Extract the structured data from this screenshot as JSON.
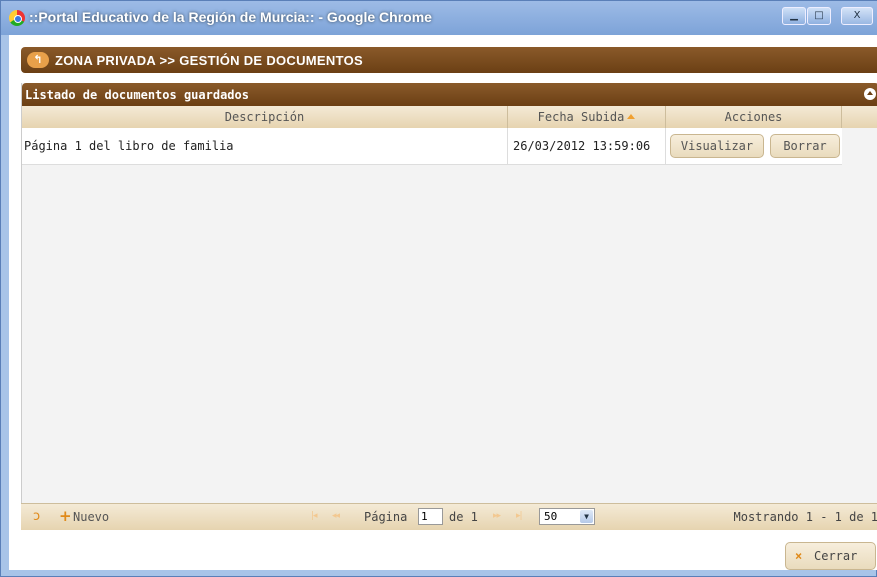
{
  "window": {
    "title": "::Portal Educativo de la Región de Murcia:: - Google Chrome",
    "min_label": "▁",
    "max_label": "□",
    "close_label": "X"
  },
  "header": {
    "back_label": "↰",
    "breadcrumb": "ZONA PRIVADA >> GESTIÓN DE DOCUMENTOS"
  },
  "grid": {
    "caption": "Listado de documentos guardados",
    "columns": [
      "Descripción",
      "Fecha Subida",
      "Acciones"
    ],
    "rows": [
      {
        "description": "Página 1 del libro de familia",
        "date": "26/03/2012 13:59:06",
        "view_label": "Visualizar",
        "delete_label": "Borrar"
      }
    ]
  },
  "pager": {
    "refresh_label": "ↄ",
    "new_plus": "+",
    "new_label": "Nuevo",
    "first_label": "|◂",
    "prev_label": "◂◂",
    "page_label": "Página",
    "page_value": "1",
    "of_label": "de 1",
    "next_label": "▸▸",
    "last_label": "▸|",
    "page_size": "50",
    "showing": "Mostrando 1 - 1 de 1"
  },
  "footer": {
    "close_label": "Cerrar",
    "close_icon": "×"
  },
  "colors": {
    "accent_brown": "#6b3f14",
    "header_tan": "#e6d4b0",
    "icon_orange": "#e08a1a"
  }
}
